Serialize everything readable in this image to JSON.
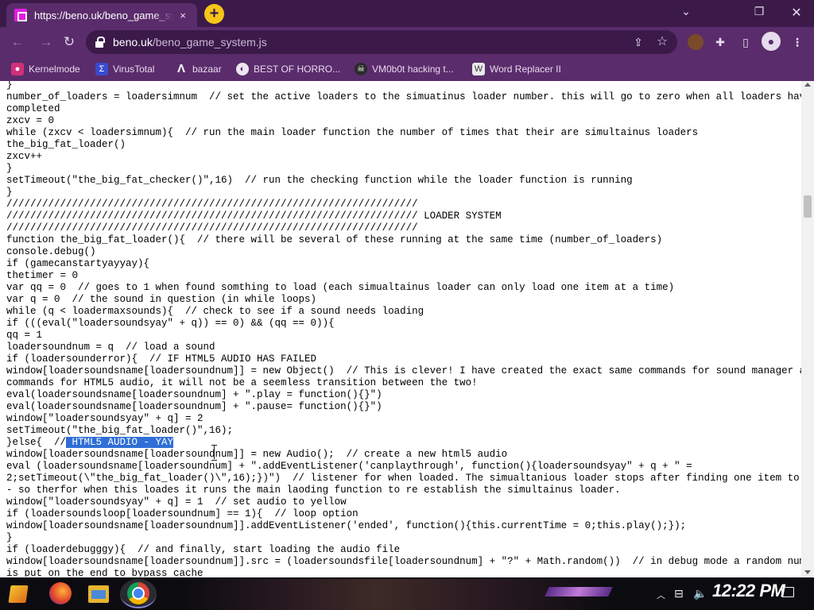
{
  "tab": {
    "title": "https://beno.uk/beno_game_sy",
    "close_icon": "×"
  },
  "window": {
    "minimize": "⌄",
    "restore": "❐",
    "close": "✕",
    "restore_label": "▭"
  },
  "toolbar": {
    "url_host": "beno.uk",
    "url_path": "/beno_game_system.js",
    "back": "←",
    "forward": "→",
    "reload": "↻",
    "share": "⇪",
    "star": "☆",
    "puzzle": "✚",
    "sidepanel": "▯",
    "profile": "●",
    "menu": "⋮"
  },
  "bookmarks": [
    {
      "label": "Kernelmode",
      "icon": "●"
    },
    {
      "label": "VirusTotal",
      "icon": "Σ"
    },
    {
      "label": "bazaar",
      "icon": "Λ"
    },
    {
      "label": "BEST OF HORRO...",
      "icon": "◐"
    },
    {
      "label": "VM0b0t hacking t...",
      "icon": "☠"
    },
    {
      "label": "Word Replacer II",
      "icon": "W"
    }
  ],
  "code_lines": [
    "}",
    "number_of_loaders = loadersimnum  // set the active loaders to the simuatinus loader number. this will go to zero when all loaders have",
    "completed",
    "zxcv = 0",
    "while (zxcv < loadersimnum){  // run the main loader function the number of times that their are simultainus loaders",
    "the_big_fat_loader()",
    "zxcv++",
    "}",
    "setTimeout(\"the_big_fat_checker()\",16)  // run the checking function while the loader function is running",
    "}",
    "/////////////////////////////////////////////////////////////////////",
    "///////////////////////////////////////////////////////////////////// LOADER SYSTEM",
    "/////////////////////////////////////////////////////////////////////",
    "function the_big_fat_loader(){  // there will be several of these running at the same time (number_of_loaders)",
    "console.debug()",
    "if (gamecanstartyayyay){",
    "thetimer = 0",
    "var qq = 0  // goes to 1 when found somthing to load (each simualtainus loader can only load one item at a time)",
    "var q = 0  // the sound in question (in while loops)",
    "while (q < loadermaxsounds){  // check to see if a sound needs loading",
    "if (((eval(\"loadersoundsyay\" + q)) == 0) && (qq == 0)){",
    "qq = 1",
    "loadersoundnum = q  // load a sound",
    "if (loadersounderror){  // IF HTML5 AUDIO HAS FAILED",
    "window[loadersoundsname[loadersoundnum]] = new Object()  // This is clever! I have created the exact same commands for sound manager asthe",
    "commands for HTML5 audio, it will not be a seemless transition between the two!",
    "eval(loadersoundsname[loadersoundnum] + \".play = function(){}\")",
    "eval(loadersoundsname[loadersoundnum] + \".pause= function(){}\")",
    "window[\"loadersoundsyay\" + q] = 2",
    "setTimeout(\"the_big_fat_loader()\",16);",
    "}else{  //",
    "window[loadersoundsname[loadersoundnum]] = new Audio();  // create a new html5 audio",
    "eval (loadersoundsname[loadersoundnum] + \".addEventListener('canplaythrough', function(){loadersoundsyay\" + q + \" =",
    "2;setTimeout(\\\"the_big_fat_loader()\\\",16);})\")  // listener for when loaded. The simualtanious loader stops after finding one item to load",
    "- so therfor when this loades it runs the main laoding function to re establish the simultainus loader.",
    "window[\"loadersoundsyay\" + q] = 1  // set audio to yellow",
    "if (loadersoundsloop[loadersoundnum] == 1){  // loop option",
    "window[loadersoundsname[loadersoundnum]].addEventListener('ended', function(){this.currentTime = 0;this.play();});",
    "}",
    "if (loaderdebugggy){  // and finally, start loading the audio file",
    "window[loadersoundsname[loadersoundnum]].src = (loadersoundsfile[loadersoundnum] + \"?\" + Math.random())  // in debug mode a random number",
    "is put on the end to bypass cache",
    "} } {"
  ],
  "selected_text": " HTML5 AUDIO - YAY",
  "taskbar": {
    "time": "12:22 PM",
    "tray_up": "︿"
  }
}
